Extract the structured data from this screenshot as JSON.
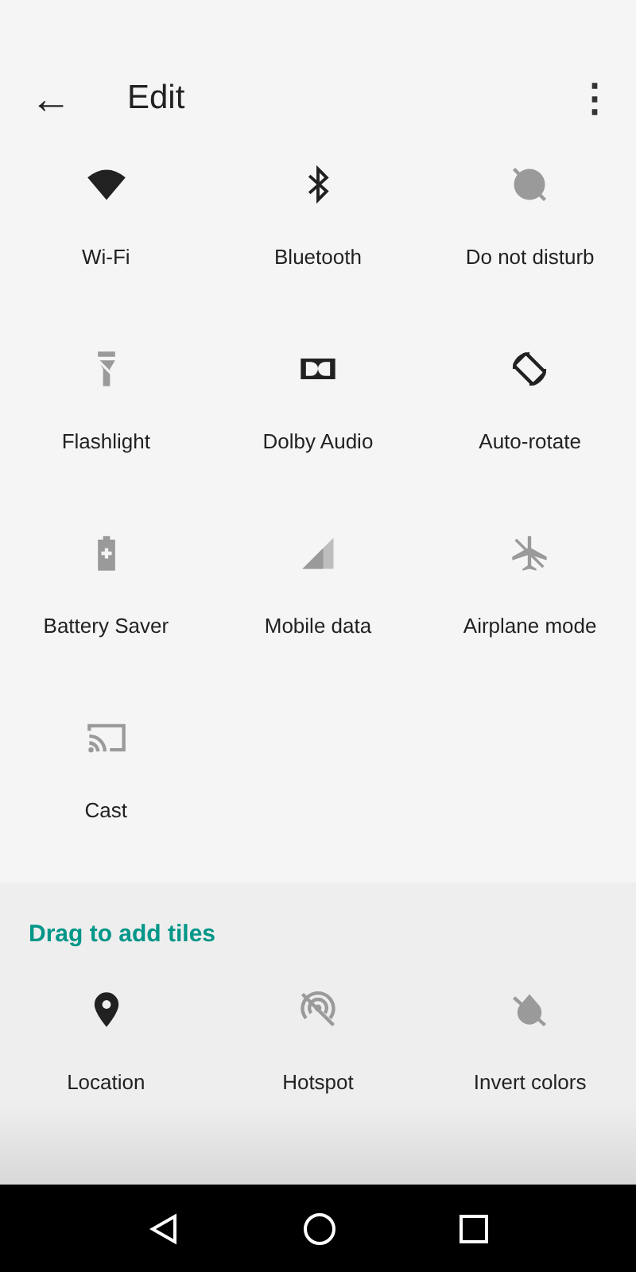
{
  "header": {
    "back": "←",
    "title": "Edit",
    "menu": "⋮"
  },
  "tiles": [
    {
      "kind": "wifi",
      "label": "Wi-Fi",
      "on": true
    },
    {
      "kind": "bluetooth",
      "label": "Bluetooth",
      "on": true
    },
    {
      "kind": "dnd",
      "label": "Do not disturb",
      "on": false
    },
    {
      "kind": "flashlight",
      "label": "Flashlight",
      "on": false
    },
    {
      "kind": "dolby",
      "label": "Dolby Audio",
      "on": true
    },
    {
      "kind": "rotate",
      "label": "Auto-rotate",
      "on": true
    },
    {
      "kind": "battery",
      "label": "Battery Saver",
      "on": false
    },
    {
      "kind": "signal",
      "label": "Mobile data",
      "on": false
    },
    {
      "kind": "airplane",
      "label": "Airplane mode",
      "on": false
    },
    {
      "kind": "cast",
      "label": "Cast",
      "on": false
    }
  ],
  "drag_section": {
    "heading": "Drag to add tiles",
    "tiles": [
      {
        "kind": "location",
        "label": "Location",
        "on": true
      },
      {
        "kind": "hotspot",
        "label": "Hotspot",
        "on": false
      },
      {
        "kind": "invert",
        "label": "Invert colors",
        "on": false
      }
    ]
  }
}
